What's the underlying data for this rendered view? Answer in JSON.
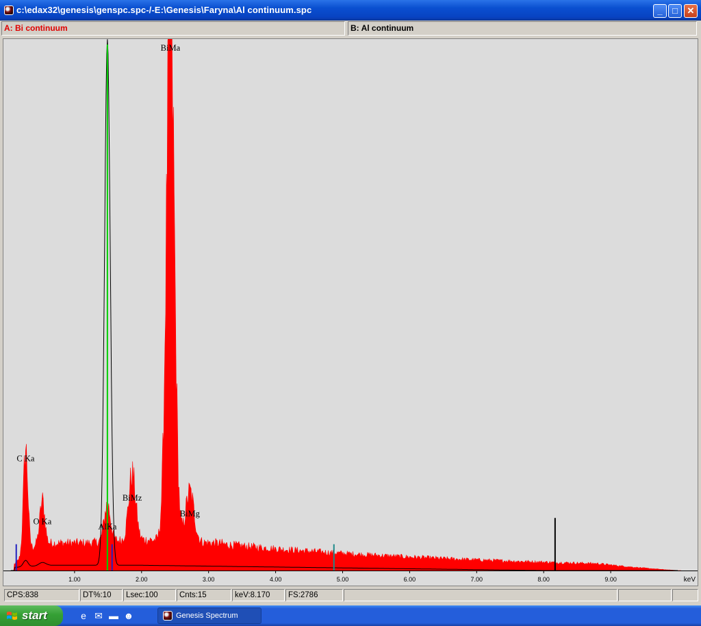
{
  "window": {
    "title": "c:\\edax32\\genesis\\genspc.spc-/-E:\\Genesis\\Faryna\\Al continuum.spc"
  },
  "caption_buttons": {
    "minimize": "_",
    "maximize": "□",
    "close": "✕"
  },
  "tabs": {
    "a_prefix": "A:",
    "a_label": "Bi continuum",
    "b_prefix": "B:",
    "b_label": "Al continuum"
  },
  "chart_data": {
    "type": "area",
    "xlabel": "keV",
    "xlim": [
      0,
      10.2
    ],
    "ticks": [
      "1.00",
      "2.00",
      "3.00",
      "4.00",
      "5.00",
      "6.00",
      "7.00",
      "8.00",
      "9.00"
    ],
    "spectrum_a": {
      "name": "Bi continuum",
      "color": "#ff0000",
      "peaks": [
        {
          "label": "C Ka",
          "x": 0.27,
          "height": 0.2
        },
        {
          "label": "O Ka",
          "x": 0.52,
          "height": 0.08
        },
        {
          "label": "AlKa",
          "x": 1.49,
          "height": 0.07
        },
        {
          "label": "BiMz",
          "x": 1.86,
          "height": 0.125
        },
        {
          "label": "BiMa",
          "x": 2.43,
          "height": 1.0
        },
        {
          "label": "BiMg",
          "x": 2.72,
          "height": 0.095
        }
      ]
    },
    "spectrum_b": {
      "name": "Al continuum",
      "color": "#000000",
      "peak_x": 1.49
    },
    "markers": [
      {
        "x": 1.49,
        "color": "#00d000",
        "height": 1.0
      },
      {
        "x": 0.13,
        "color": "#2020c0",
        "height": 0.05
      },
      {
        "x": 1.56,
        "color": "#2020c0",
        "height": 0.05
      },
      {
        "x": 4.87,
        "color": "#1e8a8a",
        "height": 0.05
      },
      {
        "x": 8.17,
        "color": "#000000",
        "height": 0.1
      }
    ]
  },
  "status": {
    "cps": "CPS:838",
    "dt": "DT%:10",
    "lsec": "Lsec:100",
    "cnts": "Cnts:15",
    "kev": "keV:8.170",
    "fs": "FS:2786"
  },
  "taskbar": {
    "start": "start",
    "task_label": "Genesis Spectrum"
  }
}
